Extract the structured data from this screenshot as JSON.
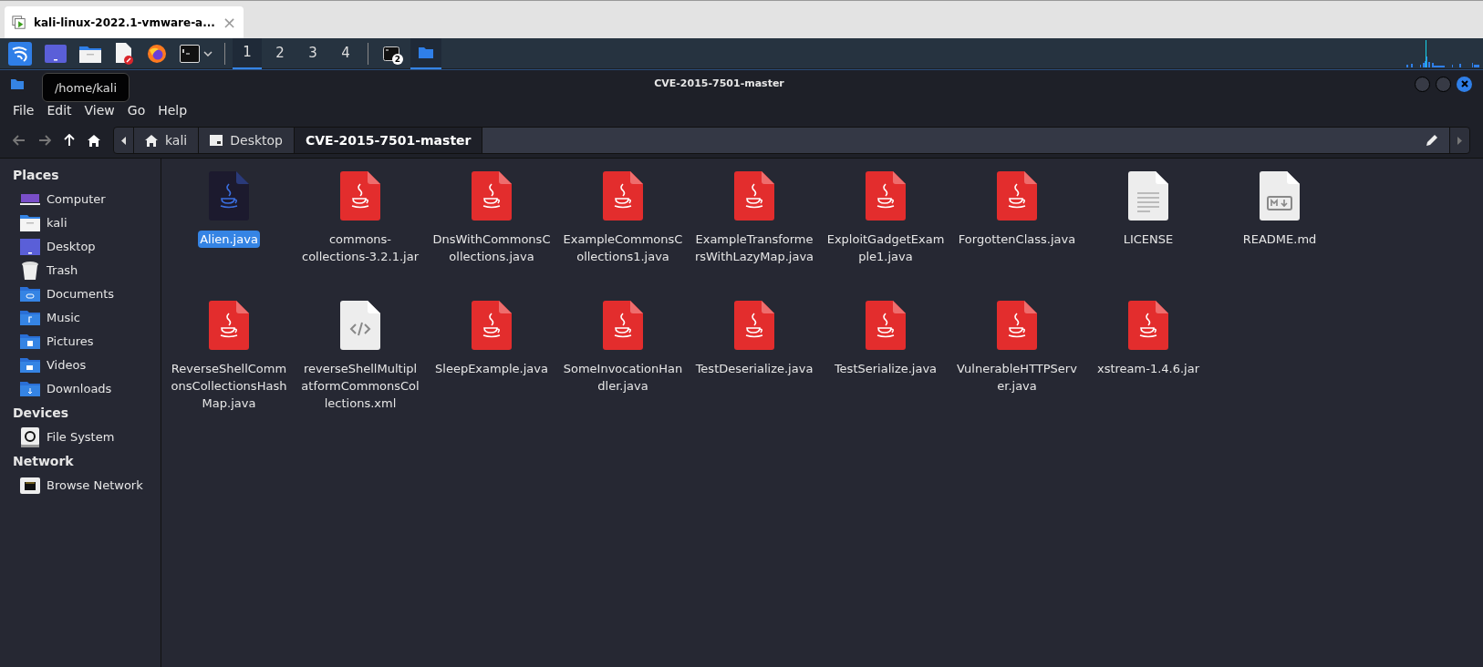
{
  "browser_tab": {
    "title": "kali-linux-2022.1-vmware-a...",
    "close": "×"
  },
  "taskbar": {
    "launchers": [
      {
        "kind": "kali"
      },
      {
        "kind": "desktop"
      },
      {
        "kind": "files"
      },
      {
        "kind": "editor"
      },
      {
        "kind": "browser"
      },
      {
        "kind": "terminal"
      }
    ],
    "workspaces": [
      {
        "label": "1",
        "selected": true
      },
      {
        "label": "2",
        "selected": false
      },
      {
        "label": "3",
        "selected": false
      },
      {
        "label": "4",
        "selected": false
      }
    ],
    "tasks": [
      {
        "kind": "terminal",
        "badge": "2",
        "selected": false
      },
      {
        "kind": "folder",
        "selected": true
      }
    ]
  },
  "window": {
    "title": "CVE-2015-7501-master"
  },
  "menu": [
    "File",
    "Edit",
    "View",
    "Go",
    "Help"
  ],
  "tooltip": "/home/kali",
  "breadcrumbs": [
    {
      "label": "kali",
      "kind": "home",
      "selected": false
    },
    {
      "label": "Desktop",
      "kind": "desktop",
      "selected": false
    },
    {
      "label": "CVE-2015-7501-master",
      "kind": "plain",
      "selected": true
    }
  ],
  "sidebar": [
    {
      "title": "Places",
      "items": [
        {
          "label": "Computer",
          "kind": "computer"
        },
        {
          "label": "kali",
          "kind": "home"
        },
        {
          "label": "Desktop",
          "kind": "desktop"
        },
        {
          "label": "Trash",
          "kind": "trash"
        },
        {
          "label": "Documents",
          "kind": "documents"
        },
        {
          "label": "Music",
          "kind": "music"
        },
        {
          "label": "Pictures",
          "kind": "pictures"
        },
        {
          "label": "Videos",
          "kind": "videos"
        },
        {
          "label": "Downloads",
          "kind": "downloads"
        }
      ]
    },
    {
      "title": "Devices",
      "items": [
        {
          "label": "File System",
          "kind": "drive"
        }
      ]
    },
    {
      "title": "Network",
      "items": [
        {
          "label": "Browse Network",
          "kind": "network"
        }
      ]
    }
  ],
  "files": [
    {
      "name": "Alien.java",
      "kind": "java",
      "selected": true
    },
    {
      "name": "commons-collections-3.2.1.jar",
      "kind": "java",
      "selected": false
    },
    {
      "name": "DnsWithCommonsCollections.java",
      "kind": "java",
      "selected": false
    },
    {
      "name": "ExampleCommonsCollections1.java",
      "kind": "java",
      "selected": false
    },
    {
      "name": "ExampleTransformersWithLazyMap.java",
      "kind": "java",
      "selected": false
    },
    {
      "name": "ExploitGadgetExample1.java",
      "kind": "java",
      "selected": false
    },
    {
      "name": "ForgottenClass.java",
      "kind": "java",
      "selected": false
    },
    {
      "name": "LICENSE",
      "kind": "text",
      "selected": false
    },
    {
      "name": "README.md",
      "kind": "markdown",
      "selected": false
    },
    {
      "name": "ReverseShellCommonsCollectionsHashMap.java",
      "kind": "java",
      "selected": false
    },
    {
      "name": "reverseShellMultiplatformCommonsCollections.xml",
      "kind": "xml",
      "selected": false
    },
    {
      "name": "SleepExample.java",
      "kind": "java",
      "selected": false
    },
    {
      "name": "SomeInvocationHandler.java",
      "kind": "java",
      "selected": false
    },
    {
      "name": "TestDeserialize.java",
      "kind": "java",
      "selected": false
    },
    {
      "name": "TestSerialize.java",
      "kind": "java",
      "selected": false
    },
    {
      "name": "VulnerableHTTPServer.java",
      "kind": "java",
      "selected": false
    },
    {
      "name": "xstream-1.4.6.jar",
      "kind": "java",
      "selected": false
    }
  ]
}
